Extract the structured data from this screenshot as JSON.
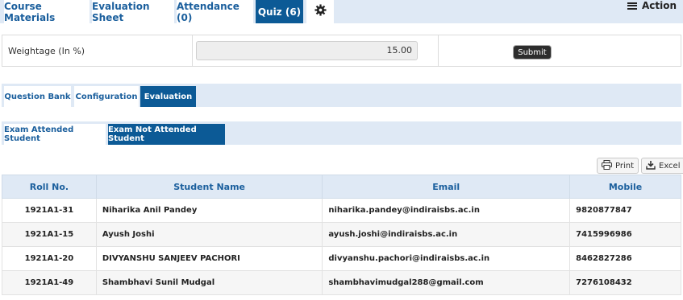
{
  "top_tabs": [
    {
      "label": "Course Materials"
    },
    {
      "label": "Evaluation Sheet"
    },
    {
      "label": "Attendance (0)"
    },
    {
      "label": "Quiz (6)"
    }
  ],
  "action_label": "Action",
  "weightage": {
    "label": "Weightage (In %)",
    "value": "15.00",
    "submit_label": "Submit"
  },
  "quiz_tabs": [
    {
      "label": "Question Bank"
    },
    {
      "label": "Configuration"
    },
    {
      "label": "Evaluation"
    }
  ],
  "eval_tabs": [
    {
      "label": "Exam Attended Student"
    },
    {
      "label": "Exam Not Attended Student"
    }
  ],
  "toolbar": {
    "print_label": "Print",
    "excel_label": "Excel"
  },
  "table": {
    "headers": [
      "Roll No.",
      "Student Name",
      "Email",
      "Mobile"
    ],
    "rows": [
      [
        "1921A1-31",
        "Niharika Anil Pandey",
        "niharika.pandey@indiraisbs.ac.in",
        "9820877847"
      ],
      [
        "1921A1-15",
        "Ayush Joshi",
        "ayush.joshi@indiraisbs.ac.in",
        "7415996986"
      ],
      [
        "1921A1-20",
        "DIVYANSHU SANJEEV PACHORI",
        "divyanshu.pachori@indiraisbs.ac.in",
        "8462827286"
      ],
      [
        "1921A1-49",
        "Shambhavi Sunil Mudgal",
        "shambhavimudgal288@gmail.com",
        "7276108432"
      ]
    ]
  },
  "colors": {
    "accent": "#0c5a96",
    "tab_bar": "#dfe9f5",
    "link": "#1b5f9d"
  },
  "icons": {
    "settings": "gear-icon",
    "menu": "hamburger-icon",
    "print": "printer-icon",
    "excel": "download-icon"
  }
}
